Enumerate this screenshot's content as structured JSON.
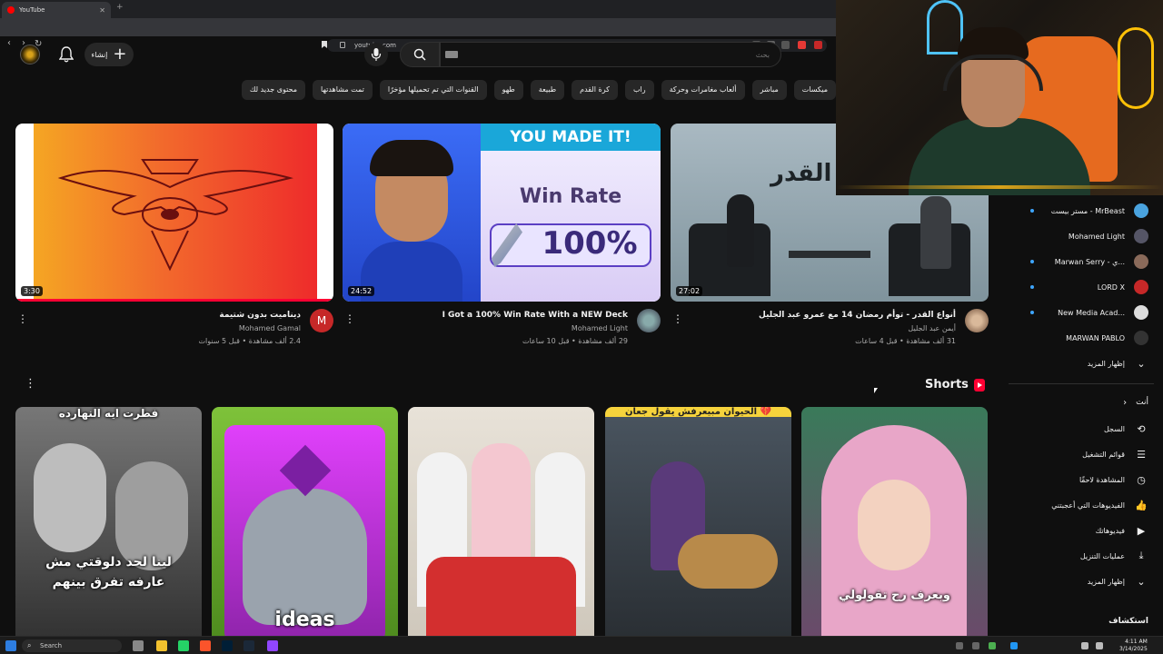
{
  "browser": {
    "tab_title": "YouTube",
    "url": "youtube.com"
  },
  "header": {
    "create_label": "إنشاء",
    "search_placeholder": "بحث"
  },
  "chips": [
    "ميكسات",
    "مباشر",
    "ألعاب مغامرات وحركة",
    "راب",
    "كرة القدم",
    "طبيعة",
    "طهو",
    "القنوات التي تم تحميلها مؤخرًا",
    "تمت مشاهدتها",
    "محتوى جديد لك"
  ],
  "videos": [
    {
      "title": "ديناميت بدون شتيمة",
      "channel": "Mohamed Gamal",
      "stats": "2.4 ألف مشاهدة • قبل 5 سنوات",
      "duration": "3:30",
      "avatar_letter": "M",
      "avatar_color": "#c62828"
    },
    {
      "title": "I Got a 100% Win Rate With a NEW Deck",
      "channel": "Mohamed Light",
      "stats": "29 ألف مشاهدة • قبل 10 ساعات",
      "duration": "24:52",
      "thumb_banner": "YOU MADE IT!",
      "thumb_text1": "Win Rate",
      "thumb_text2": "100%"
    },
    {
      "title": "أنواع القدر - توأم رمضان 14 مع عمرو عبد الجليل",
      "channel": "أيمن عبد الجليل",
      "stats": "31 ألف مشاهدة • قبل 4 ساعات",
      "duration": "27:02",
      "thumb_word": "القدر"
    }
  ],
  "shorts": {
    "heading": "Shorts",
    "items": [
      {
        "caption_top": "فطرت ايه النهارده",
        "caption_bottom": "لينا لحد دلوقتي مش عارفه تفرق بينهم"
      },
      {
        "caption_top": "",
        "caption_bottom": "ideas"
      },
      {
        "caption_top": "",
        "caption_bottom": ""
      },
      {
        "caption_top": "الحيوان مبيعرفش يقول جعان 💔",
        "caption_bottom": ""
      },
      {
        "caption_top": "",
        "caption_bottom": "وبعرف رح تقولولي"
      }
    ]
  },
  "sidebar": {
    "subscriptions": [
      {
        "name": "مستر بيست - MrBeast",
        "new": true
      },
      {
        "name": "Mohamed Light",
        "new": false
      },
      {
        "name": "Marwan Serry - ي...",
        "new": true
      },
      {
        "name": "LORD X",
        "new": true
      },
      {
        "name": "New Media Acad...",
        "new": true
      },
      {
        "name": "MARWAN PABLO",
        "new": false
      }
    ],
    "show_more": "إظهار المزيد",
    "you_heading": "أنت",
    "you_items": [
      {
        "label": "السجل",
        "icon": "history-icon"
      },
      {
        "label": "قوائم التشغيل",
        "icon": "playlist-icon"
      },
      {
        "label": "المشاهدة لاحقًا",
        "icon": "watch-later-icon"
      },
      {
        "label": "الفيديوهات التي أعجبتني",
        "icon": "like-icon"
      },
      {
        "label": "فيديوهاتك",
        "icon": "your-videos-icon"
      },
      {
        "label": "عمليات التنزيل",
        "icon": "download-icon"
      }
    ],
    "show_more_2": "إظهار المزيد",
    "explore_heading": "استكشاف"
  },
  "taskbar": {
    "search_label": "Search",
    "time": "4:11 AM",
    "date": "3/14/2025"
  }
}
